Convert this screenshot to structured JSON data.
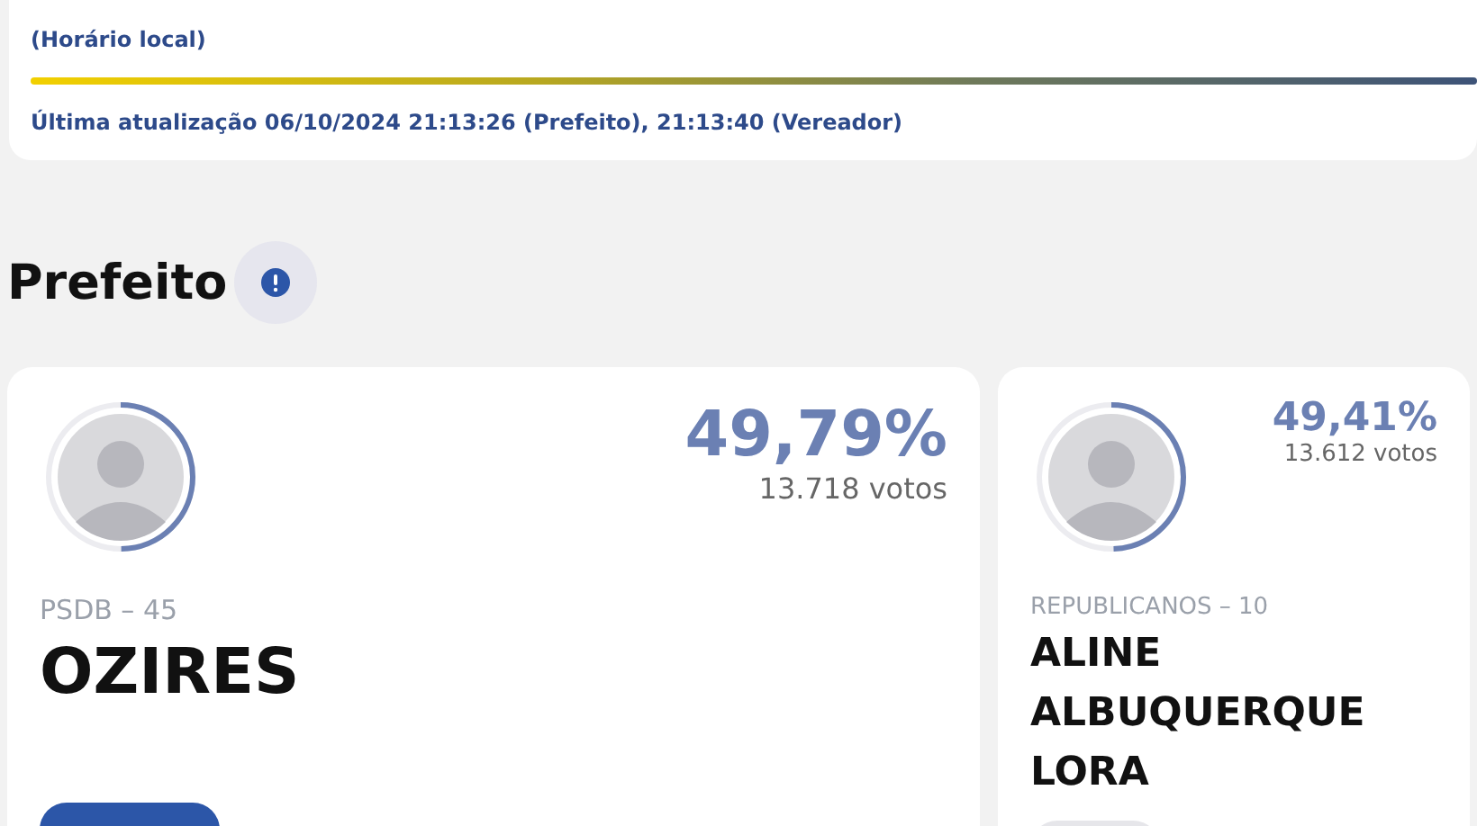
{
  "update_panel": {
    "timezone_note": "(Horário local)",
    "progress": {
      "level": 1.0
    },
    "last_update": "Última atualização 06/10/2024 21:13:26 (Prefeito), 21:13:40 (Vereador)"
  },
  "section": {
    "title": "Prefeito"
  },
  "candidates": [
    {
      "kind": "leader",
      "percent": "49,79%",
      "votes": "13.718 votos",
      "party": "PSDB – 45",
      "name": "OZIRES",
      "level": 0.4979,
      "color": "#2c56a8"
    },
    {
      "kind": "runner_up",
      "percent": "49,41%",
      "votes": "13.612 votos",
      "party": "REPUBLICANOS – 10",
      "name": "ALINE ALBUQUERQUE LORA",
      "level": 0.4941,
      "color": "#e6e6ea"
    }
  ]
}
